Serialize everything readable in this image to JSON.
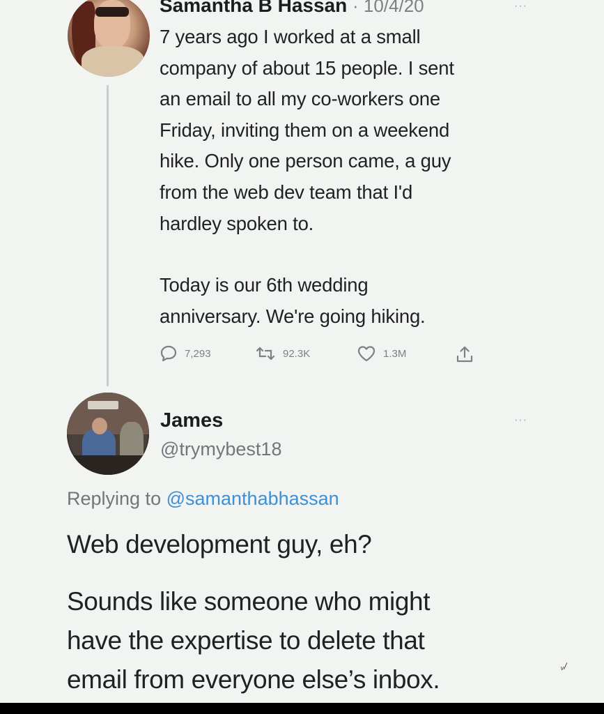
{
  "tweet1": {
    "author_name": "Samantha B Hassan",
    "date": "· 10/4/20",
    "more": "···",
    "lines": [
      "7 years ago I worked at a small",
      "company of about 15 people. I sent",
      "an email to all my co-workers one",
      "Friday, inviting them on a weekend",
      "hike. Only one person came, a guy",
      "from the web dev team that I'd",
      "hardley spoken to."
    ],
    "lines2": [
      "Today is our 6th wedding",
      "anniversary. We're going hiking."
    ],
    "actions": {
      "replies": "7,293",
      "retweets": "92.3K",
      "likes": "1.3M"
    },
    "icons": {
      "reply": "reply-icon",
      "retweet": "retweet-icon",
      "like": "heart-icon",
      "share": "share-icon"
    }
  },
  "tweet2": {
    "author_name": "James",
    "handle": "@trymybest18",
    "more": "···",
    "replying_prefix": "Replying to",
    "replying_mention": "@samanthabhassan",
    "lines": [
      "Web development guy, eh?"
    ],
    "lines2": [
      "Sounds like someone who might",
      "have the expertise to delete that",
      "email from everyone else’s inbox."
    ]
  },
  "watermark": "ᵥ/",
  "colors": {
    "background": "#f2f4f1",
    "text": "#1b1d1f",
    "muted": "#70777c",
    "link": "#3d8fd6",
    "thread_line": "#c9cdd1"
  }
}
